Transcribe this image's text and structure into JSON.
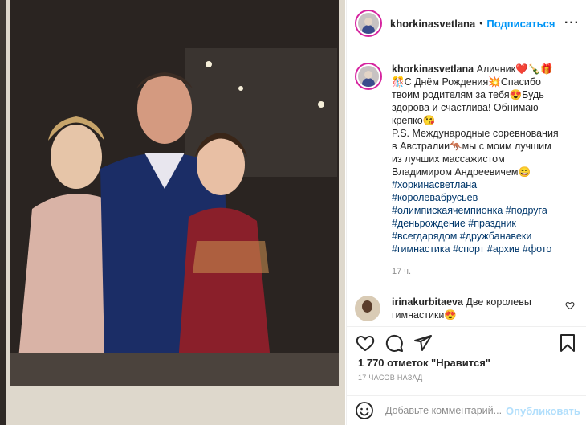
{
  "post": {
    "username": "khorkinasvetlana",
    "follow_label": "Подписаться",
    "more_icon": "more-horizontal-icon",
    "caption_lines": [
      "Аличник❤️🍾🎁",
      "🎊С Днём Рождения💥Спасибо",
      "твоим родителям за тебя😍Будь",
      "здорова и счастлива! Обнимаю",
      "крепко😘",
      "P.S. Международные соревнования",
      "в Австралии🦘мы с моим лучшим",
      "из лучших массажистом",
      "Владимиром Андреевичем😄"
    ],
    "hashtags": [
      "#хоркинасветлана",
      "#королевабрусьев",
      "#олимпискаячемпионка #подруга",
      "#деньрождение #праздник",
      "#всегдарядом #дружбанавеки",
      "#гимнастика #спорт #архив #фото"
    ],
    "time_ago": "17 ч."
  },
  "comment": {
    "username": "irinakurbitaeva",
    "text": "Две королевы гимнастики😍"
  },
  "actions": {
    "like_icon": "heart-icon",
    "comment_icon": "comment-icon",
    "share_icon": "share-icon",
    "save_icon": "bookmark-icon"
  },
  "likes": "1 770 отметок \"Нравится\"",
  "date": "17 часов назад",
  "add_comment": {
    "placeholder": "Добавьте комментарий...",
    "post_label": "Опубликовать",
    "emoji_icon": "emoji-icon"
  },
  "colors": {
    "accent": "#0095f6",
    "hashtag": "#00376b",
    "muted": "#8e8e8e",
    "post_disabled": "#b2dffc"
  }
}
